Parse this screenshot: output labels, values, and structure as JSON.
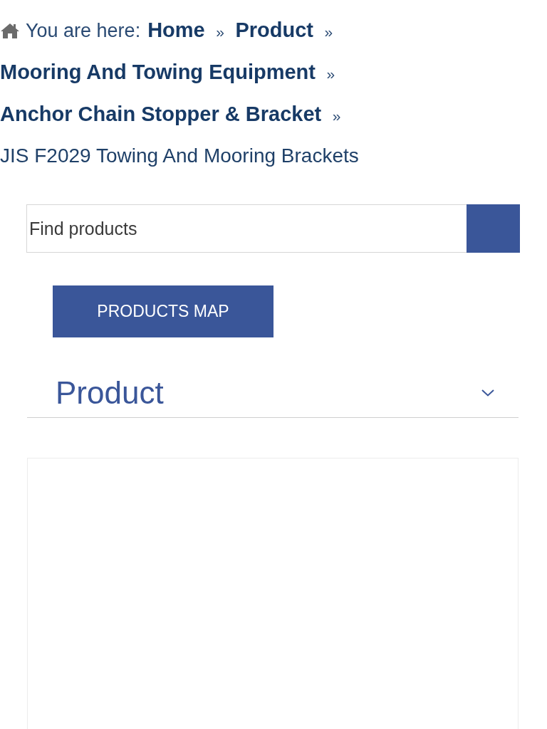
{
  "breadcrumb": {
    "label": "You are here:",
    "items": [
      {
        "kind": "link",
        "text": "Home"
      },
      {
        "kind": "separator",
        "text": "»"
      },
      {
        "kind": "link",
        "text": "Product"
      },
      {
        "kind": "separator",
        "text": "»"
      },
      {
        "kind": "link",
        "text": "Mooring And Towing Equipment"
      },
      {
        "kind": "separator",
        "text": "»"
      },
      {
        "kind": "link",
        "text": "Anchor Chain Stopper & Bracket"
      },
      {
        "kind": "separator",
        "text": "»"
      },
      {
        "kind": "current",
        "text": "JIS F2029 Towing And Mooring Brackets"
      }
    ]
  },
  "search": {
    "placeholder": "Find products"
  },
  "products_map_button": {
    "label": "PRODUCTS MAP"
  },
  "accordion": {
    "title": "Product",
    "expanded": false
  }
}
